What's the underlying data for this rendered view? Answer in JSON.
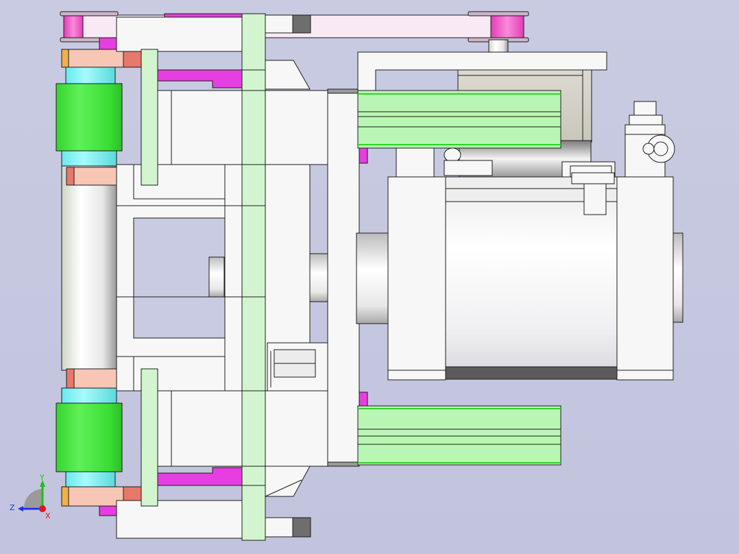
{
  "viewport": {
    "background_top": "#c9cbe2",
    "background_bottom": "#c2c4de"
  },
  "colors": {
    "outline": "#1a1a1a",
    "part_white": "#f7f7f7",
    "part_light": "#eeeeee",
    "rail_green": "#d2f5cf",
    "roller_green": "#3fe33a",
    "roller_cyan": "#7ef3f5",
    "bearing_salmon": "#f7c6b4",
    "bearing_red": "#e8786b",
    "magenta": "#e63ee0",
    "pulley_pink": "#f266c9",
    "belt_pink": "#f8e9f5",
    "cylinder_green": "#b9f6b3",
    "cylinder_edge": "#2fd22a",
    "motor_tan": "#d8d6c8",
    "dark_cap": "#6e6e6e",
    "orange_tab": "#f2b04a"
  },
  "triad": {
    "x_label": "X",
    "y_label": "Y",
    "z_label": "Z",
    "y_color": "#19c019",
    "z_color": "#1f2ee6",
    "x_color": "#e0141e"
  }
}
